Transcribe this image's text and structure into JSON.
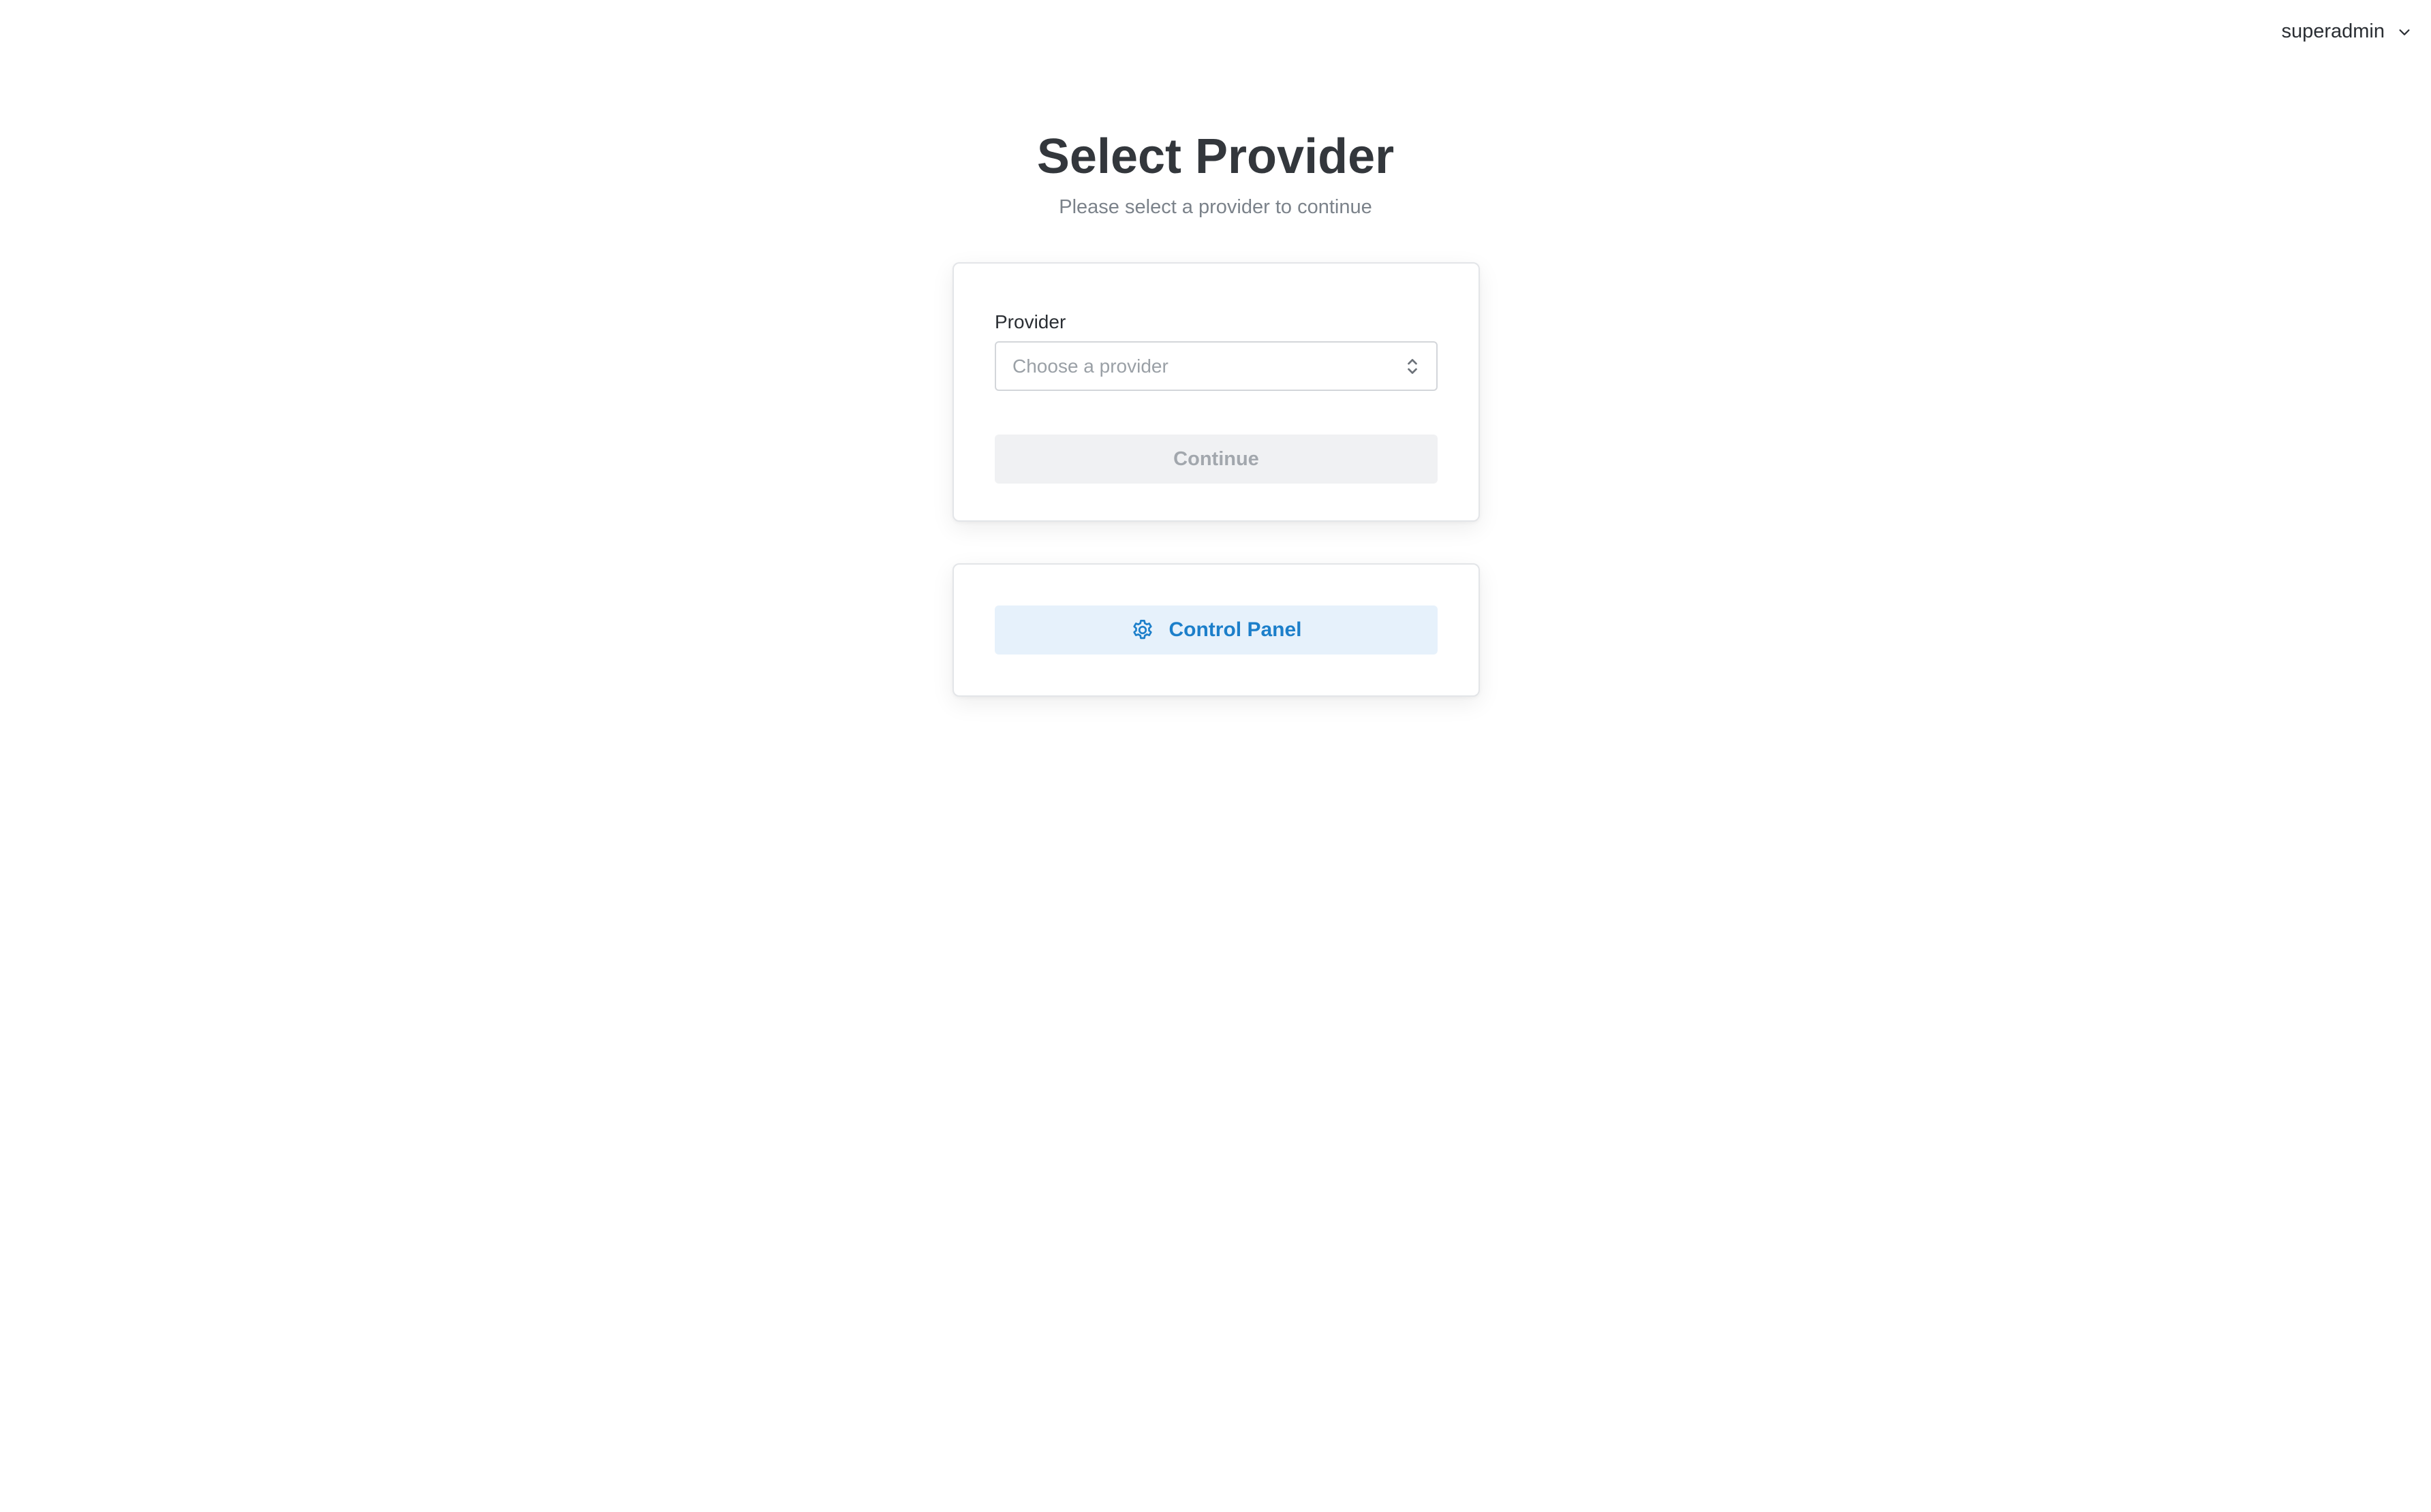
{
  "user_menu": {
    "username": "superadmin",
    "icon": "chevron-down-icon"
  },
  "header": {
    "title": "Select Provider",
    "subtitle": "Please select a provider to continue"
  },
  "provider_form": {
    "label": "Provider",
    "select_placeholder": "Choose a provider",
    "select_icon": "chevron-up-down-icon",
    "continue_label": "Continue",
    "continue_disabled": true
  },
  "control_panel": {
    "label": "Control Panel",
    "icon": "gear-icon"
  },
  "colors": {
    "accent": "#1c7fca",
    "accent_bg": "#e6f1fb",
    "title": "#33373c",
    "muted": "#7b828a",
    "disabled_bg": "#f0f1f3",
    "disabled_text": "#a2a7ad"
  }
}
